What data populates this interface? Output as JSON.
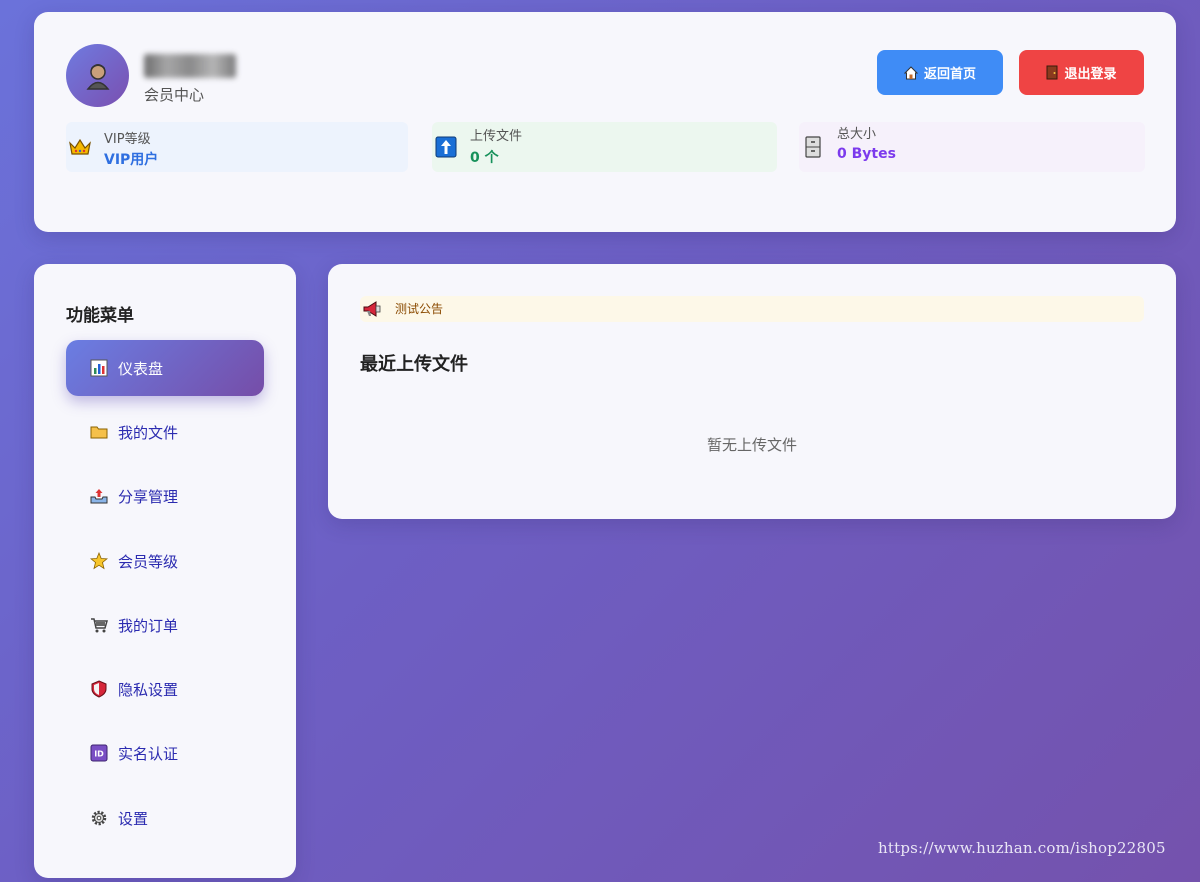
{
  "header": {
    "member_center": "会员中心",
    "home_button": "返回首页",
    "logout_button": "退出登录",
    "stats": {
      "vip": {
        "label": "VIP等级",
        "value": "VIP用户"
      },
      "upload": {
        "label": "上传文件",
        "value": "0 个"
      },
      "size": {
        "label": "总大小",
        "value": "0 Bytes"
      }
    }
  },
  "sidebar": {
    "title": "功能菜单",
    "items": [
      {
        "label": "仪表盘",
        "icon": "bar-chart-icon"
      },
      {
        "label": "我的文件",
        "icon": "folder-icon"
      },
      {
        "label": "分享管理",
        "icon": "outbox-tray-icon"
      },
      {
        "label": "会员等级",
        "icon": "star-icon"
      },
      {
        "label": "我的订单",
        "icon": "shopping-cart-icon"
      },
      {
        "label": "隐私设置",
        "icon": "shield-icon"
      },
      {
        "label": "实名认证",
        "icon": "id-icon"
      },
      {
        "label": "设置",
        "icon": "gear-icon"
      }
    ]
  },
  "main": {
    "notice": "测试公告",
    "recent_title": "最近上传文件",
    "empty_text": "暂无上传文件"
  },
  "watermark": "https://www.huzhan.com/ishop22805",
  "colors": {
    "accent_blue": "#3f8cf6",
    "danger_red": "#ef4444",
    "success_green": "#16915a",
    "purple": "#7c3aed"
  }
}
